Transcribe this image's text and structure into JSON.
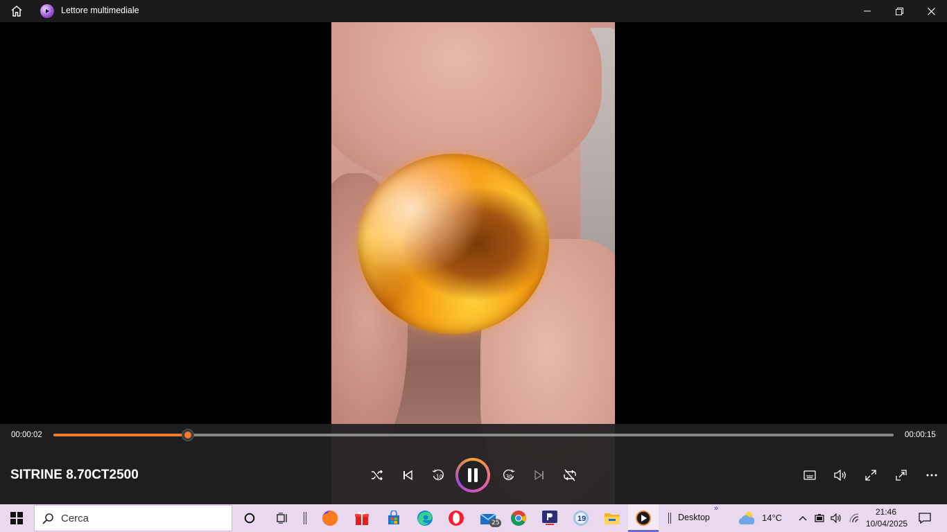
{
  "window": {
    "title": "Lettore multimediale"
  },
  "player": {
    "current_time": "00:00:02",
    "duration": "00:00:15",
    "progress": 0.16,
    "media_title": "SITRINE 8.70CT2500"
  },
  "taskbar": {
    "search_placeholder": "Cerca",
    "desktop_label": "Desktop",
    "weather_temp": "14°C",
    "clock_time": "21:46",
    "clock_date": "10/04/2025",
    "mail_badge": "25",
    "calendar_day": "19"
  },
  "colors": {
    "accent": "#f27a2c",
    "titlebar": "#1b1b1b",
    "taskbar": "#ead9ee"
  }
}
